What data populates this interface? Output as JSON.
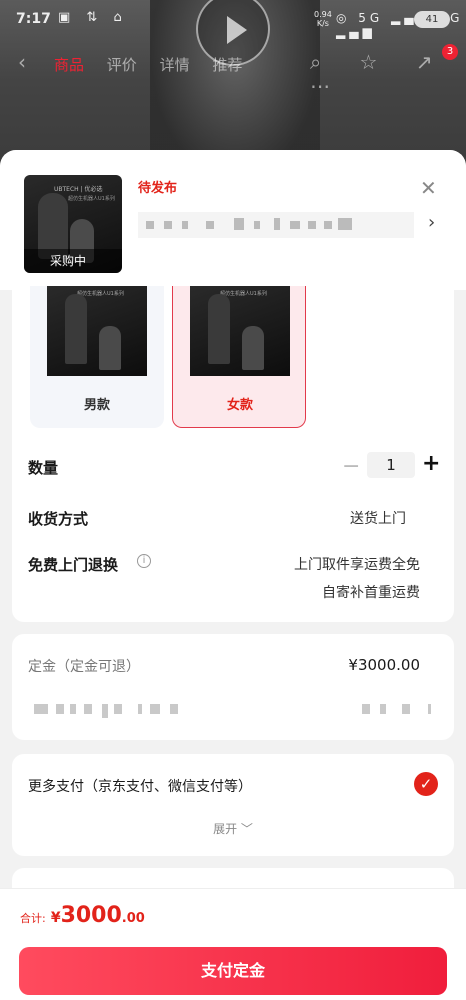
{
  "status_bar": {
    "time": "7:17",
    "left_icons": "▣ ⇅ ⌂",
    "net_speed_value": "0.94",
    "net_speed_unit": "K/s",
    "right_signals": "◎ 5G ▂▄▆ 5G ▂▄▆",
    "battery": "41"
  },
  "nav": {
    "back": "‹",
    "tabs": [
      "商品",
      "评价",
      "详情",
      "推荐"
    ],
    "icons": "⌕ ☆ ↗ ⋯",
    "badge": "3"
  },
  "product": {
    "thumb_brand": "UBTECH | 优必选",
    "thumb_title": "超仿生机器人U1系列",
    "thumb_tag": "采购中",
    "status": "待发布",
    "close": "✕",
    "chevron": "›"
  },
  "variants": [
    {
      "label": "男款",
      "selected": false
    },
    {
      "label": "女款",
      "selected": true
    }
  ],
  "quantity": {
    "label": "数量",
    "minus": "−",
    "value": "1",
    "plus": "+"
  },
  "delivery": {
    "label": "收货方式",
    "value": "送货上门"
  },
  "free_return": {
    "label": "免费上门退换",
    "info_icon": "i",
    "line1": "上门取件享运费全免",
    "line2": "自寄补首重运费"
  },
  "deposit": {
    "label": "定金（定金可退）",
    "value": "¥3000.00"
  },
  "payment": {
    "label": "更多支付（京东支付、微信支付等）",
    "check": "✓",
    "expand": "展开 ﹀"
  },
  "footer": {
    "total_label": "合计:",
    "currency": "¥",
    "amount_int": "3000",
    "amount_dec": ".00",
    "button": "支付定金"
  },
  "colors": {
    "accent": "#e2231a",
    "button_start": "#ff4b5e",
    "button_end": "#f01e3c"
  }
}
